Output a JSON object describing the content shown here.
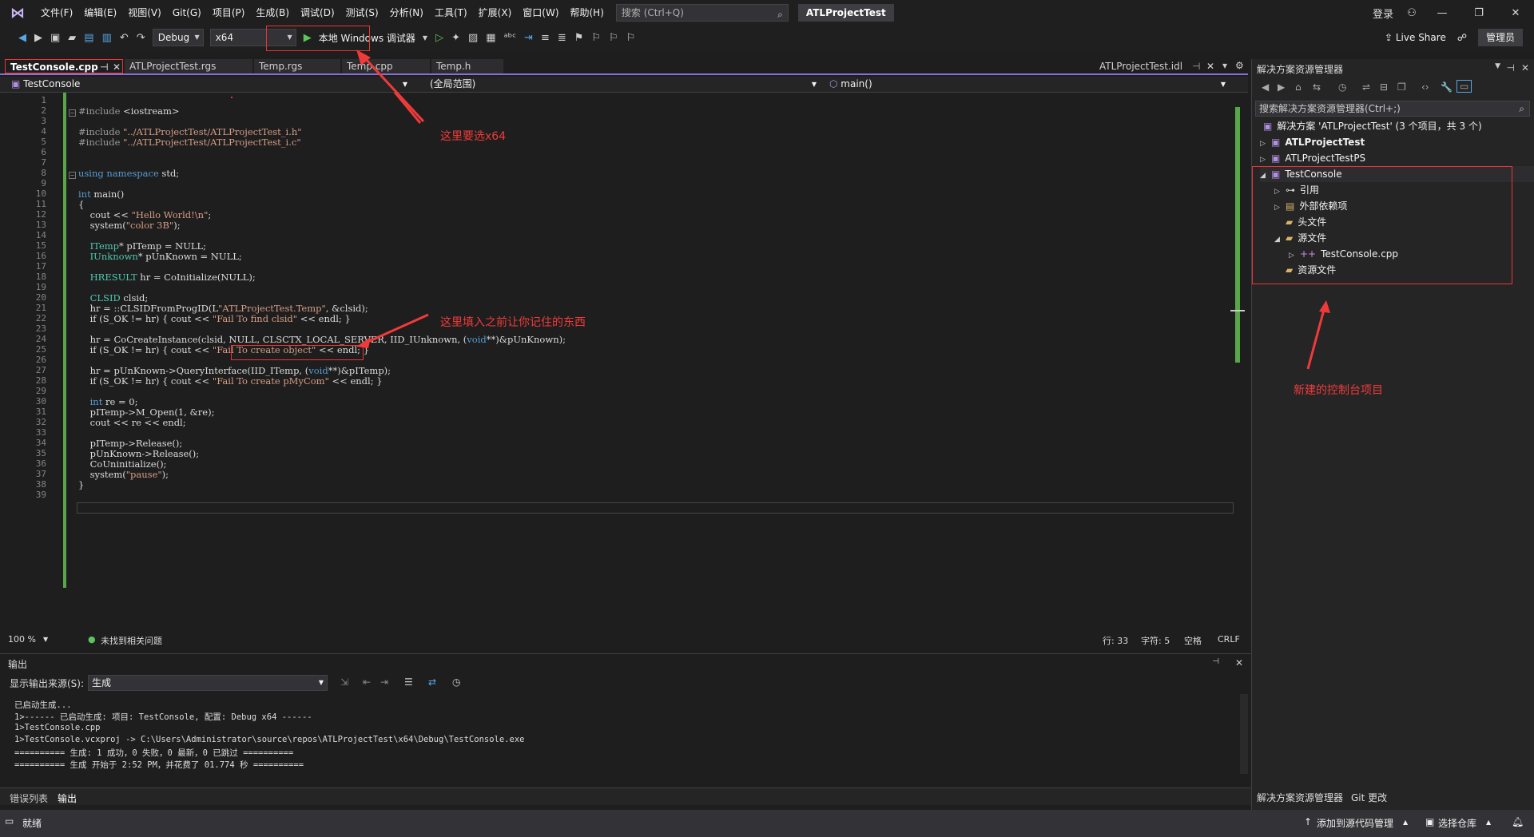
{
  "menubar": {
    "items": [
      "文件(F)",
      "编辑(E)",
      "视图(V)",
      "Git(G)",
      "项目(P)",
      "生成(B)",
      "调试(D)",
      "测试(S)",
      "分析(N)",
      "工具(T)",
      "扩展(X)",
      "窗口(W)",
      "帮助(H)"
    ],
    "search_placeholder": "搜索 (Ctrl+Q)",
    "project_title": "ATLProjectTest",
    "login": "登录"
  },
  "toolbar": {
    "config": "Debug",
    "platform": "x64",
    "run_label": "本地 Windows 调试器",
    "live_share": "Live Share",
    "admin": "管理员"
  },
  "editor_tabs": [
    "TestConsole.cpp",
    "ATLProjectTest.rgs",
    "Temp.rgs",
    "Temp.cpp",
    "Temp.h",
    "ATLProjectTest.idl"
  ],
  "navbar": {
    "project": "TestConsole",
    "scope": "(全局范围)",
    "member": "main()"
  },
  "code_lines": [
    "",
    "#include <iostream>",
    "",
    "#include \"../ATLProjectTest/ATLProjectTest_i.h\"",
    "#include \"../ATLProjectTest/ATLProjectTest_i.c\"",
    "",
    "",
    "using namespace std;",
    "",
    "int main()",
    "{",
    "    cout << \"Hello World!\\n\";",
    "    system(\"color 3B\");",
    "",
    "    ITemp* pITemp = NULL;",
    "    IUnknown* pUnKnown = NULL;",
    "",
    "    HRESULT hr = CoInitialize(NULL);",
    "",
    "    CLSID clsid;",
    "    hr = ::CLSIDFromProgID(L\"ATLProjectTest.Temp\", &clsid);",
    "    if (S_OK != hr) { cout << \"Fail To find clsid\" << endl; }",
    "",
    "    hr = CoCreateInstance(clsid, NULL, CLSCTX_LOCAL_SERVER, IID_IUnknown, (void**)&pUnKnown);",
    "    if (S_OK != hr) { cout << \"Fail To create object\" << endl; }",
    "",
    "    hr = pUnKnown->QueryInterface(IID_ITemp, (void**)&pITemp);",
    "    if (S_OK != hr) { cout << \"Fail To create pMyCom\" << endl; }",
    "",
    "    int re = 0;",
    "    pITemp->M_Open(1, &re);",
    "    cout << re << endl;",
    "",
    "    pITemp->Release();",
    "    pUnKnown->Release();",
    "    CoUninitialize();",
    "    system(\"pause\");",
    "}",
    ""
  ],
  "annotations": {
    "platform_note": "这里要选x64",
    "progid_note": "这里填入之前让你记住的东西",
    "project_note": "新建的控制台项目"
  },
  "editor_status": {
    "zoom": "100 %",
    "issues": "未找到相关问题",
    "line": "行: 33",
    "char": "字符: 5",
    "spaces": "空格",
    "eol": "CRLF"
  },
  "output": {
    "title": "输出",
    "source_label": "显示输出来源(S):",
    "source_value": "生成",
    "lines": [
      "已启动生成...",
      "1>------ 已启动生成: 项目: TestConsole, 配置: Debug x64 ------",
      "1>TestConsole.cpp",
      "1>TestConsole.vcxproj -> C:\\Users\\Administrator\\source\\repos\\ATLProjectTest\\x64\\Debug\\TestConsole.exe",
      "========== 生成: 1 成功，0 失败，0 最新，0 已跳过 ==========",
      "========== 生成 开始于 2:52 PM，并花费了 01.774 秒 =========="
    ]
  },
  "bottom_tabs": [
    "错误列表",
    "输出"
  ],
  "solution_explorer": {
    "title": "解决方案资源管理器",
    "search_placeholder": "搜索解决方案资源管理器(Ctrl+;)",
    "solution": "解决方案 'ATLProjectTest' (3 个项目，共 3 个)",
    "projects": [
      "ATLProjectTest",
      "ATLProjectTestPS",
      "TestConsole"
    ],
    "children": [
      "引用",
      "外部依赖项",
      "头文件",
      "源文件",
      "TestConsole.cpp",
      "资源文件"
    ],
    "bottom_tabs": [
      "解决方案资源管理器",
      "Git 更改"
    ]
  },
  "statusbar": {
    "ready": "就绪",
    "source_control": "添加到源代码管理",
    "repo": "选择仓库"
  }
}
